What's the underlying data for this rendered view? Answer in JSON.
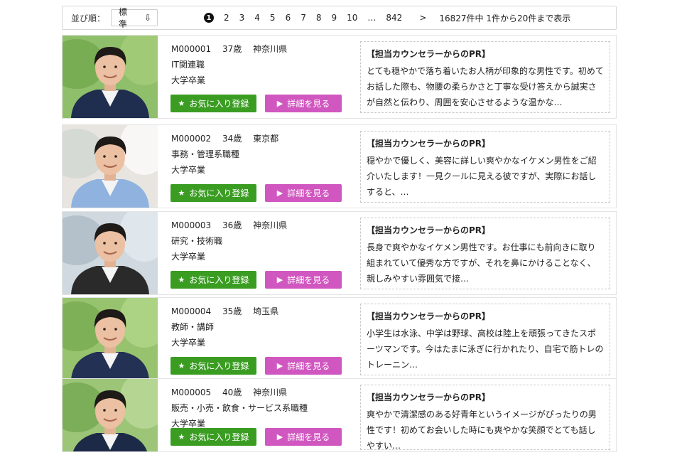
{
  "toolbar": {
    "sort_label": "並び順：",
    "sort_value": "標準",
    "sort_icon": "sort-arrow-icon",
    "pages": [
      "1",
      "2",
      "3",
      "4",
      "5",
      "6",
      "7",
      "8",
      "9",
      "10"
    ],
    "ellipsis": "…",
    "last_page": "842",
    "next": ">",
    "total_text": "16827件中 1件から20件まで表示"
  },
  "buttons": {
    "favorite": "お気に入り登録",
    "detail": "詳細を見る"
  },
  "colors": {
    "favorite": "#3a9d22",
    "detail": "#d157c0"
  },
  "profiles": [
    {
      "id": "M000001",
      "age": "37歳",
      "pref": "神奈川県",
      "job": "IT関連職",
      "edu": "大学卒業",
      "pr_title": "【担当カウンセラーからのPR】",
      "pr_text": "とても穏やかで落ち着いたお人柄が印象的な男性です。初めてお話した際も、物腰の柔らかさと丁寧な受け答えから誠実さが自然と伝わり、周囲を安心させるような温かな…"
    },
    {
      "id": "M000002",
      "age": "34歳",
      "pref": "東京都",
      "job": "事務・管理系職種",
      "edu": "大学卒業",
      "pr_title": "【担当カウンセラーからのPR】",
      "pr_text": "穏やかで優しく、美容に詳しい爽やかなイケメン男性をご紹介いたします！一見クールに見える彼ですが、実際にお話しすると、…"
    },
    {
      "id": "M000003",
      "age": "36歳",
      "pref": "神奈川県",
      "job": "研究・技術職",
      "edu": "大学卒業",
      "pr_title": "【担当カウンセラーからのPR】",
      "pr_text": "長身で爽やかなイケメン男性です。お仕事にも前向きに取り組まれていて優秀な方ですが、それを鼻にかけることなく、親しみやすい雰囲気で接…"
    },
    {
      "id": "M000004",
      "age": "35歳",
      "pref": "埼玉県",
      "job": "教師・講師",
      "edu": "大学卒業",
      "pr_title": "【担当カウンセラーからのPR】",
      "pr_text": "小学生は水泳、中学は野球、高校は陸上を頑張ってきたスポーツマンです。今はたまに泳ぎに行かれたり、自宅で筋トレのトレーニン…"
    },
    {
      "id": "M000005",
      "age": "40歳",
      "pref": "神奈川県",
      "job": "販売・小売・飲食・サービス系職種",
      "edu": "大学卒業",
      "pr_title": "【担当カウンセラーからのPR】",
      "pr_text": "爽やかで清潔感のある好青年というイメージがぴったりの男性です！初めてお会いした時にも爽やかな笑顔でとても話しやすい…"
    }
  ]
}
